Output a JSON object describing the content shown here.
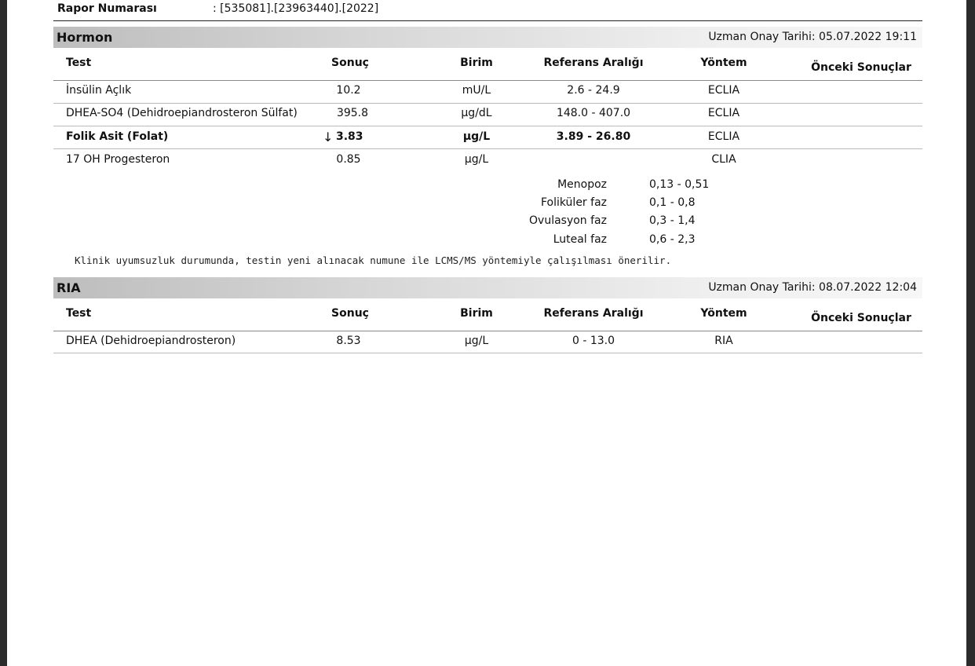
{
  "report": {
    "label": "Rapor Numarası",
    "value": ": [535081].[23963440].[2022]"
  },
  "columns": {
    "test": "Test",
    "result": "Sonuç",
    "unit": "Birim",
    "ref": "Referans Aralığı",
    "method": "Yöntem",
    "previous": "Önceki Sonuçlar"
  },
  "hormon": {
    "title": "Hormon",
    "approval": "Uzman Onay Tarihi: 05.07.2022 19:11",
    "rows": [
      {
        "test": "İnsülin Açlık",
        "flag": "",
        "result": "10.2",
        "unit": "mU/L",
        "ref": "2.6 - 24.9",
        "method": "ECLIA",
        "bold": false
      },
      {
        "test": "DHEA-SO4  (Dehidroepiandrosteron Sülfat)",
        "flag": "",
        "result": "395.8",
        "unit": "µg/dL",
        "ref": "148.0 - 407.0",
        "method": "ECLIA",
        "bold": false
      },
      {
        "test": "Folik Asit (Folat)",
        "flag": "↓",
        "result": "3.83",
        "unit": "µg/L",
        "ref": "3.89 - 26.80",
        "method": "ECLIA",
        "bold": true
      },
      {
        "test": "17 OH Progesteron",
        "flag": "",
        "result": "0.85",
        "unit": "µg/L",
        "ref": "",
        "method": "CLIA",
        "bold": false
      }
    ],
    "phases": [
      {
        "name": "Menopoz",
        "range": "0,13 - 0,51"
      },
      {
        "name": "Foliküler faz",
        "range": "0,1 - 0,8"
      },
      {
        "name": "Ovulasyon faz",
        "range": "0,3 - 1,4"
      },
      {
        "name": "Luteal faz",
        "range": "0,6 - 2,3"
      }
    ],
    "note": "Klinik uyumsuzluk durumunda, testin yeni alınacak numune ile LCMS/MS yöntemiyle çalışılması önerilir."
  },
  "ria": {
    "title": "RIA",
    "approval": "Uzman Onay Tarihi: 08.07.2022 12:04",
    "rows": [
      {
        "test": "DHEA  (Dehidroepiandrosteron)",
        "flag": "",
        "result": "8.53",
        "unit": "µg/L",
        "ref": "0 - 13.0",
        "method": "RIA",
        "bold": false
      }
    ]
  }
}
